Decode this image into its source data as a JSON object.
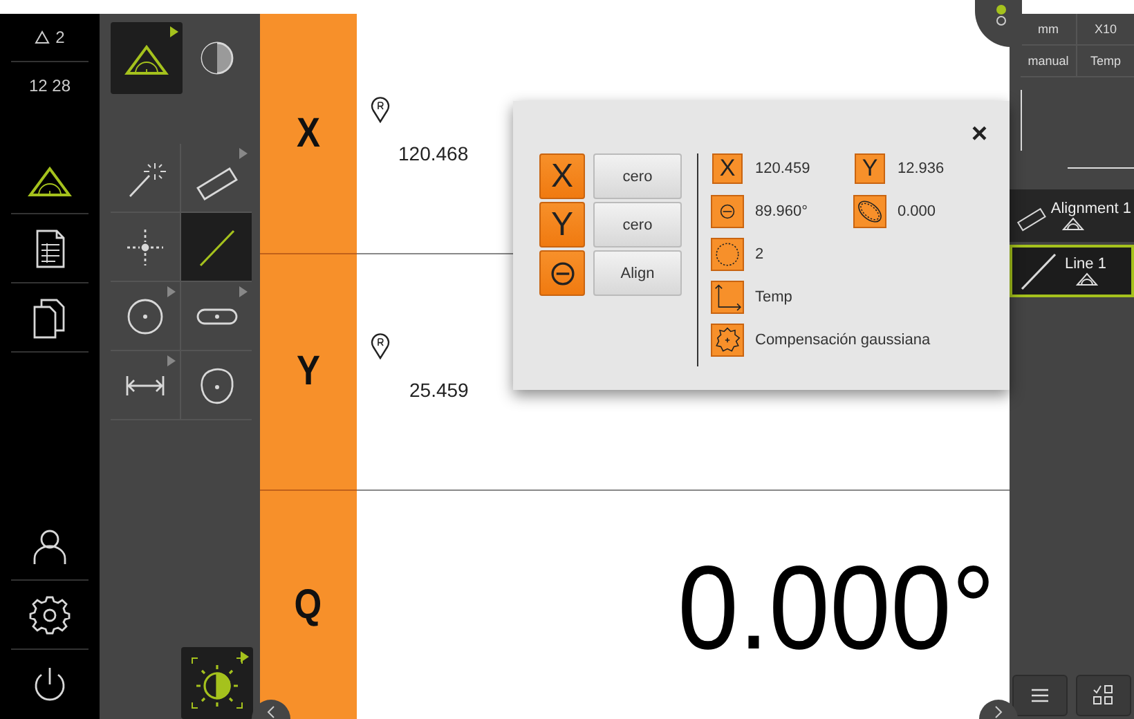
{
  "status": {
    "feature_count": "2",
    "time": "12 28"
  },
  "nav": [
    {
      "kind": "measure",
      "selected": true
    },
    {
      "kind": "report",
      "selected": false
    },
    {
      "kind": "files",
      "selected": false
    }
  ],
  "nav_bottom": [
    {
      "kind": "user"
    },
    {
      "kind": "settings"
    },
    {
      "kind": "power"
    }
  ],
  "tool_header": [
    {
      "kind": "manual-measure",
      "selected": true,
      "submenu": true
    },
    {
      "kind": "contrast",
      "selected": false,
      "submenu": false
    }
  ],
  "tools": [
    {
      "kind": "wand",
      "selected": false,
      "submenu": false
    },
    {
      "kind": "alignment",
      "selected": false,
      "submenu": true
    },
    {
      "kind": "point",
      "selected": false,
      "submenu": false
    },
    {
      "kind": "line",
      "selected": true,
      "submenu": false
    },
    {
      "kind": "circle",
      "selected": false,
      "submenu": true
    },
    {
      "kind": "slot",
      "selected": false,
      "submenu": true
    },
    {
      "kind": "distance",
      "selected": false,
      "submenu": true
    },
    {
      "kind": "blob",
      "selected": false,
      "submenu": false
    }
  ],
  "light_tool": {
    "kind": "light",
    "selected": true,
    "submenu": true
  },
  "axes": [
    {
      "label": "X",
      "reference": "120.468"
    },
    {
      "label": "Y",
      "reference": "25.459"
    },
    {
      "label": "Q",
      "value": "0.000°"
    }
  ],
  "dialog": {
    "close": "×",
    "axis_buttons": [
      {
        "kind": "letter",
        "symbol": "X",
        "action": "cero"
      },
      {
        "kind": "letter",
        "symbol": "Y",
        "action": "cero"
      },
      {
        "kind": "theta",
        "action": "Align"
      }
    ],
    "results": [
      {
        "kind": "x",
        "label": "X",
        "value": "120.459"
      },
      {
        "kind": "y",
        "label": "Y",
        "value": "12.936"
      },
      {
        "kind": "angle",
        "value": "89.960°"
      },
      {
        "kind": "form",
        "value": "0.000"
      },
      {
        "kind": "points",
        "value": "2"
      },
      {
        "kind": "coordinates",
        "value": "Temp"
      },
      {
        "kind": "filter",
        "value": "Compensación gaussiana"
      }
    ]
  },
  "settings": [
    "mm",
    "X10",
    "manual",
    "Temp"
  ],
  "features": [
    {
      "kind": "alignment",
      "name": "Alignment 1",
      "selected": false
    },
    {
      "kind": "line",
      "name": "Line 1",
      "selected": true
    }
  ]
}
